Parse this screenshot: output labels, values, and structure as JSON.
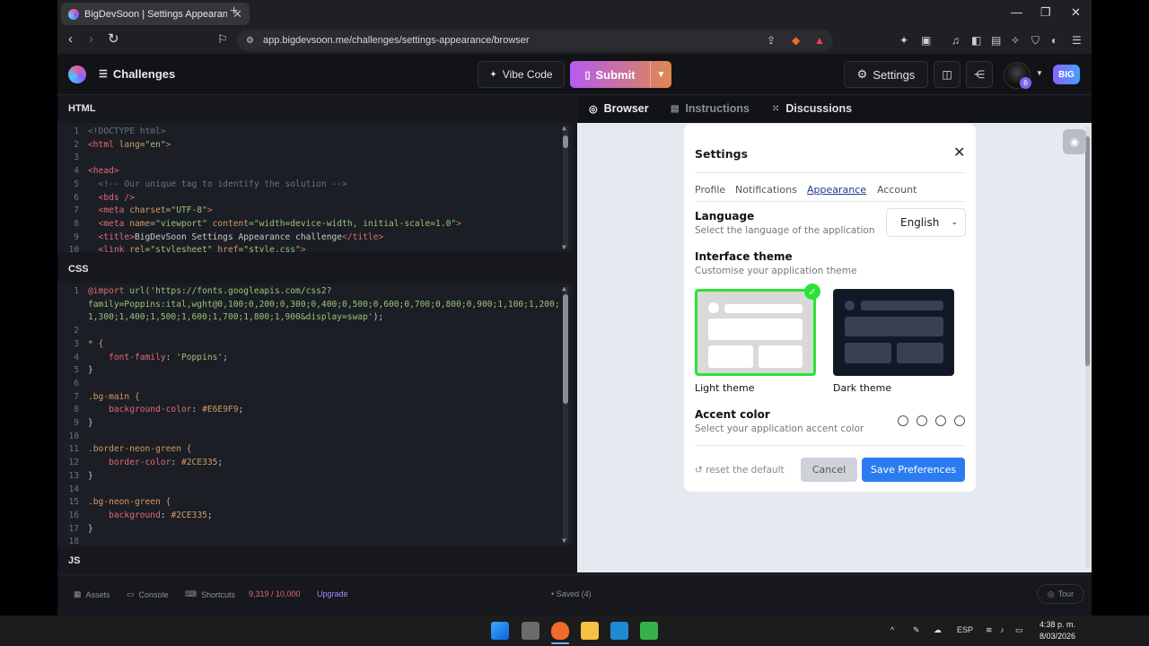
{
  "browser": {
    "tab_title": "BigDevSoon | Settings Appearan",
    "url": "app.bigdevsoon.me/challenges/settings-appearance/browser"
  },
  "header": {
    "challenges": "Challenges",
    "vibe_code": "Vibe Code",
    "submit": "Submit",
    "settings": "Settings",
    "avatar_badge": "6",
    "big": "BIG"
  },
  "editor": {
    "html_title": "HTML",
    "css_title": "CSS",
    "js_title": "JS",
    "html_lines": [
      {
        "n": "1",
        "parts": [
          {
            "t": "<!DOCTYPE html>",
            "c": "c"
          }
        ]
      },
      {
        "n": "2",
        "parts": [
          {
            "t": "<html ",
            "c": "k"
          },
          {
            "t": "lang",
            "c": "a"
          },
          {
            "t": "=\"en\"",
            "c": "s"
          },
          {
            "t": ">",
            "c": "k"
          }
        ]
      },
      {
        "n": "3",
        "parts": []
      },
      {
        "n": "4",
        "parts": [
          {
            "t": "<head>",
            "c": "k"
          }
        ]
      },
      {
        "n": "5",
        "parts": [
          {
            "t": "  <!-- Our unique tag to identify the solution -->",
            "c": "c"
          }
        ]
      },
      {
        "n": "6",
        "parts": [
          {
            "t": "  <bds />",
            "c": "k"
          }
        ]
      },
      {
        "n": "7",
        "parts": [
          {
            "t": "  <meta ",
            "c": "k"
          },
          {
            "t": "charset",
            "c": "a"
          },
          {
            "t": "=\"UTF-8\"",
            "c": "s"
          },
          {
            "t": ">",
            "c": "k"
          }
        ]
      },
      {
        "n": "8",
        "parts": [
          {
            "t": "  <meta ",
            "c": "k"
          },
          {
            "t": "name",
            "c": "a"
          },
          {
            "t": "=\"viewport\" ",
            "c": "s"
          },
          {
            "t": "content",
            "c": "a"
          },
          {
            "t": "=\"width=device-width, initial-scale=1.0\"",
            "c": "s"
          },
          {
            "t": ">",
            "c": "k"
          }
        ]
      },
      {
        "n": "9",
        "parts": [
          {
            "t": "  <title>",
            "c": "k"
          },
          {
            "t": "BigDevSoon Settings Appearance challenge",
            "c": "p"
          },
          {
            "t": "</title>",
            "c": "k"
          }
        ]
      },
      {
        "n": "10",
        "parts": [
          {
            "t": "  <link ",
            "c": "k"
          },
          {
            "t": "rel",
            "c": "a"
          },
          {
            "t": "=\"stylesheet\" ",
            "c": "s"
          },
          {
            "t": "href",
            "c": "a"
          },
          {
            "t": "=\"style.css\"",
            "c": "s"
          },
          {
            "t": ">",
            "c": "k"
          }
        ]
      }
    ],
    "css_lines": [
      {
        "n": "1",
        "parts": [
          {
            "t": "@import ",
            "c": "k"
          },
          {
            "t": "url('https://fonts.googleapis.com/css2?",
            "c": "s"
          }
        ]
      },
      {
        "n": "",
        "parts": [
          {
            "t": "family=Poppins:ital,wght@0,100;0,200;0,300;0,400;0,500;0,600;0,700;0,800;0,900;1,100;1,200;",
            "c": "s"
          }
        ]
      },
      {
        "n": "",
        "parts": [
          {
            "t": "1,300;1,400;1,500;1,600;1,700;1,800;1,900&display=swap'",
            "c": "s"
          },
          {
            "t": ");",
            "c": "p"
          }
        ]
      },
      {
        "n": "2",
        "parts": []
      },
      {
        "n": "3",
        "parts": [
          {
            "t": "* {",
            "c": "a"
          }
        ]
      },
      {
        "n": "4",
        "parts": [
          {
            "t": "    font-family",
            "c": "k"
          },
          {
            "t": ": ",
            "c": "p"
          },
          {
            "t": "'Poppins'",
            "c": "s"
          },
          {
            "t": ";",
            "c": "p"
          }
        ]
      },
      {
        "n": "5",
        "parts": [
          {
            "t": "}",
            "c": "p"
          }
        ]
      },
      {
        "n": "6",
        "parts": []
      },
      {
        "n": "7",
        "parts": [
          {
            "t": ".bg-main {",
            "c": "a"
          }
        ]
      },
      {
        "n": "8",
        "parts": [
          {
            "t": "    background-color",
            "c": "k"
          },
          {
            "t": ": ",
            "c": "p"
          },
          {
            "t": "#E6E9F9",
            "c": "a"
          },
          {
            "t": ";",
            "c": "p"
          }
        ]
      },
      {
        "n": "9",
        "parts": [
          {
            "t": "}",
            "c": "p"
          }
        ]
      },
      {
        "n": "10",
        "parts": []
      },
      {
        "n": "11",
        "parts": [
          {
            "t": ".border-neon-green {",
            "c": "a"
          }
        ]
      },
      {
        "n": "12",
        "parts": [
          {
            "t": "    border-color",
            "c": "k"
          },
          {
            "t": ": ",
            "c": "p"
          },
          {
            "t": "#2CE335",
            "c": "a"
          },
          {
            "t": ";",
            "c": "p"
          }
        ]
      },
      {
        "n": "13",
        "parts": [
          {
            "t": "}",
            "c": "p"
          }
        ]
      },
      {
        "n": "14",
        "parts": []
      },
      {
        "n": "15",
        "parts": [
          {
            "t": ".bg-neon-green {",
            "c": "a"
          }
        ]
      },
      {
        "n": "16",
        "parts": [
          {
            "t": "    background",
            "c": "k"
          },
          {
            "t": ": ",
            "c": "p"
          },
          {
            "t": "#2CE335",
            "c": "a"
          },
          {
            "t": ";",
            "c": "p"
          }
        ]
      },
      {
        "n": "17",
        "parts": [
          {
            "t": "}",
            "c": "p"
          }
        ]
      },
      {
        "n": "18",
        "parts": []
      }
    ]
  },
  "footer": {
    "assets": "Assets",
    "console": "Console",
    "shortcuts": "Shortcuts",
    "count": "9,319 / 10,000",
    "upgrade": "Upgrade",
    "saved": "• Saved (4)",
    "tour": "Tour"
  },
  "preview_tabs": {
    "browser": "Browser",
    "instructions": "Instructions",
    "discussions": "Discussions"
  },
  "settings_card": {
    "title": "Settings",
    "tabs": [
      "Profile",
      "Notifications",
      "Appearance",
      "Account"
    ],
    "language_label": "Language",
    "language_desc": "Select the language of the application",
    "language_value": "English",
    "theme_label": "Interface theme",
    "theme_desc": "Customise your application theme",
    "light_label": "Light theme",
    "dark_label": "Dark theme",
    "accent_label": "Accent color",
    "accent_desc": "Select your application accent color",
    "reset": "reset the default",
    "cancel": "Cancel",
    "save": "Save Preferences"
  },
  "taskbar": {
    "lang": "ESP",
    "time": "4:38 p. m.",
    "date": "8/03/2026"
  },
  "colors": {
    "neon_green": "#2CE335",
    "save_blue": "#2B7CF0",
    "submit_start": "#B45CF2",
    "submit_end": "#E0874F"
  }
}
